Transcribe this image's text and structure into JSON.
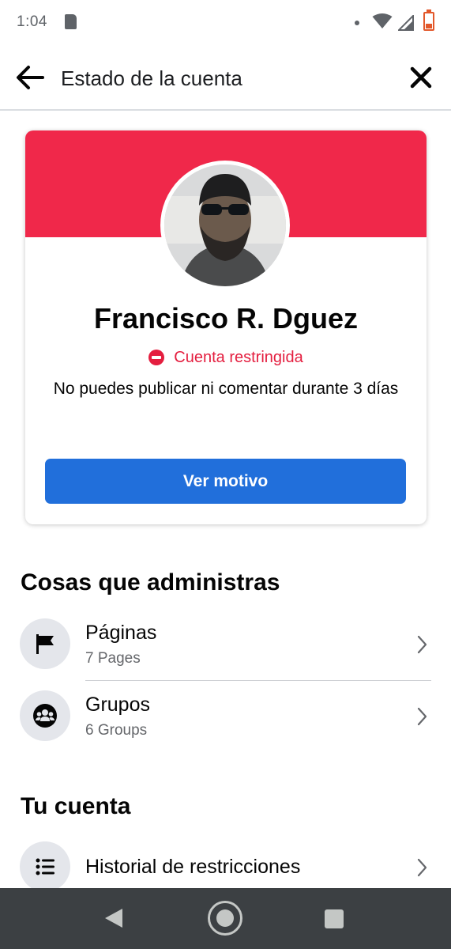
{
  "status_bar": {
    "time": "1:04",
    "icons": [
      "sd-card-icon",
      "notification-dot-icon",
      "wifi-icon",
      "cell-signal-icon",
      "battery-icon"
    ]
  },
  "header": {
    "title": "Estado de la cuenta",
    "back_icon": "arrow-left-icon",
    "close_icon": "close-icon"
  },
  "profile_card": {
    "banner_color": "#f0284a",
    "name": "Francisco R. Dguez",
    "status_icon": "no-entry-icon",
    "status": "Cuenta restringida",
    "status_color": "#e41e3f",
    "description": "No puedes publicar ni comentar durante 3 días",
    "button_label": "Ver motivo",
    "button_color": "#216fdb"
  },
  "managed_section": {
    "title": "Cosas que administras",
    "items": [
      {
        "icon": "flag-icon",
        "label": "Páginas",
        "sub": "7 Pages"
      },
      {
        "icon": "groups-icon",
        "label": "Grupos",
        "sub": "6 Groups"
      }
    ]
  },
  "account_section": {
    "title": "Tu cuenta",
    "items": [
      {
        "icon": "list-icon",
        "label": "Historial de restricciones"
      }
    ]
  },
  "nav_bar": {
    "icons": [
      "nav-back-icon",
      "nav-home-icon",
      "nav-recents-icon"
    ]
  }
}
